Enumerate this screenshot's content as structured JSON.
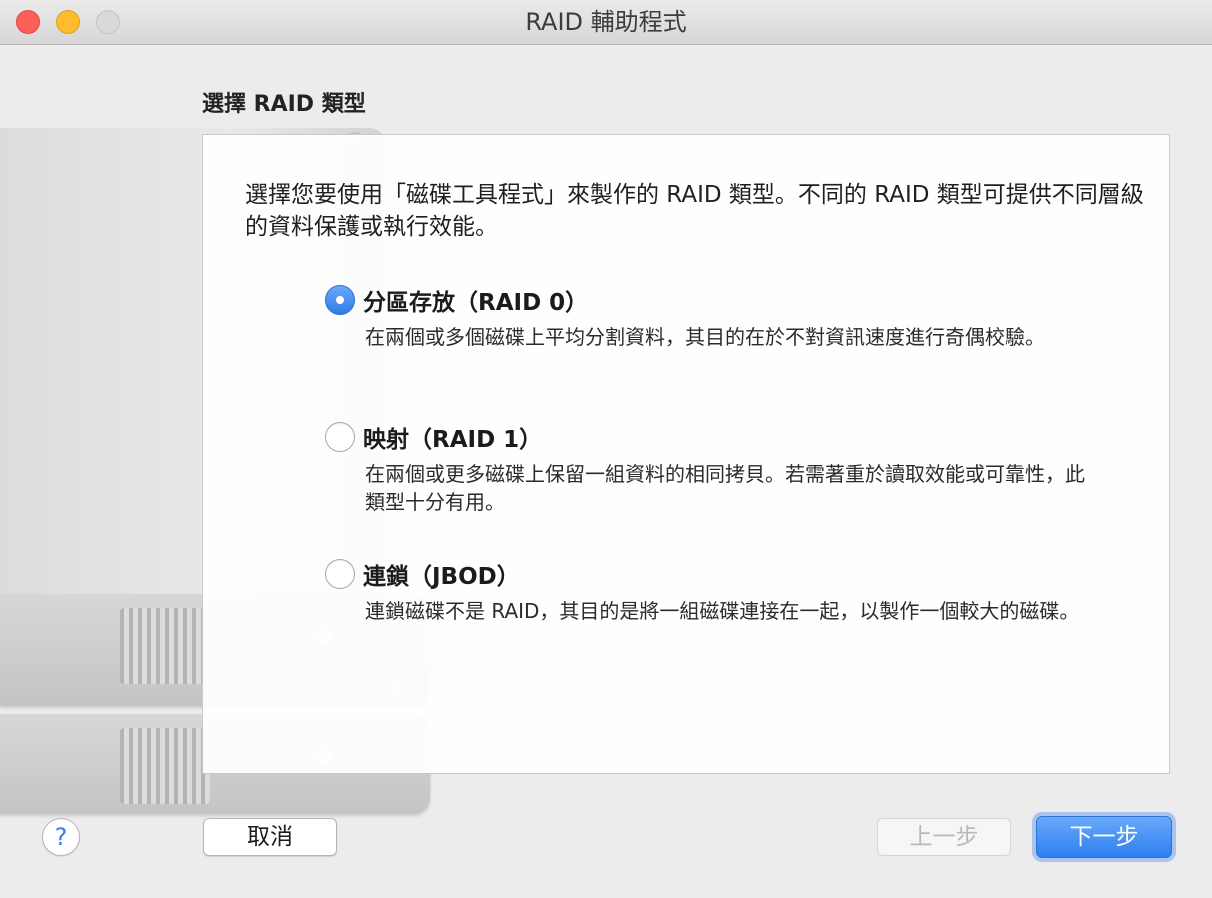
{
  "window": {
    "title": "RAID 輔助程式"
  },
  "page": {
    "heading": "選擇 RAID 類型",
    "intro": "選擇您要使用「磁碟工具程式」來製作的 RAID 類型。不同的 RAID 類型可提供不同層級的資料保護或執行效能。"
  },
  "options": [
    {
      "label": "分區存放（RAID 0）",
      "description": "在兩個或多個磁碟上平均分割資料，其目的在於不對資訊速度進行奇偶校驗。",
      "selected": true
    },
    {
      "label": "映射（RAID 1）",
      "description": "在兩個或更多磁碟上保留一組資料的相同拷貝。若需著重於讀取效能或可靠性，此類型十分有用。",
      "selected": false
    },
    {
      "label": "連鎖（JBOD）",
      "description": "連鎖磁碟不是 RAID，其目的是將一組磁碟連接在一起，以製作一個較大的磁碟。",
      "selected": false
    }
  ],
  "buttons": {
    "help": "?",
    "cancel": "取消",
    "back": "上一步",
    "next": "下一步"
  },
  "colors": {
    "accent": "#2f7de9",
    "close": "#fc5f57",
    "minimize": "#fdbc2e",
    "zoom_disabled": "#d9d9d9"
  }
}
